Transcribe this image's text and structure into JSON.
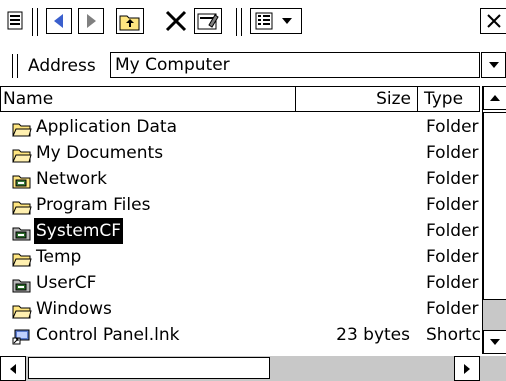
{
  "toolbar": {
    "icons": [
      "app-menu-icon",
      "back-icon",
      "forward-icon",
      "up-folder-icon",
      "delete-icon",
      "properties-icon",
      "view-icon",
      "close-icon"
    ]
  },
  "address": {
    "label": "Address",
    "value": "My Computer"
  },
  "columns": {
    "name": "Name",
    "size": "Size",
    "type": "Type"
  },
  "files": [
    {
      "name": "Application Data",
      "size": "",
      "type": "Folder",
      "icon": "folder-icon"
    },
    {
      "name": "My Documents",
      "size": "",
      "type": "Folder",
      "icon": "folder-icon"
    },
    {
      "name": "Network",
      "size": "",
      "type": "Folder",
      "icon": "network-folder-icon"
    },
    {
      "name": "Program Files",
      "size": "",
      "type": "Folder",
      "icon": "folder-icon"
    },
    {
      "name": "SystemCF",
      "size": "",
      "type": "Folder",
      "icon": "storage-card-icon",
      "selected": true
    },
    {
      "name": "Temp",
      "size": "",
      "type": "Folder",
      "icon": "folder-icon"
    },
    {
      "name": "UserCF",
      "size": "",
      "type": "Folder",
      "icon": "storage-card-icon"
    },
    {
      "name": "Windows",
      "size": "",
      "type": "Folder",
      "icon": "folder-icon"
    },
    {
      "name": "Control Panel.lnk",
      "size": "23 bytes",
      "type": "Shortc",
      "icon": "shortcut-icon"
    }
  ],
  "colors": {
    "selection_bg": "#000000",
    "folder_fill": "#ffe680",
    "scroll_track": "#c8c8c8"
  }
}
